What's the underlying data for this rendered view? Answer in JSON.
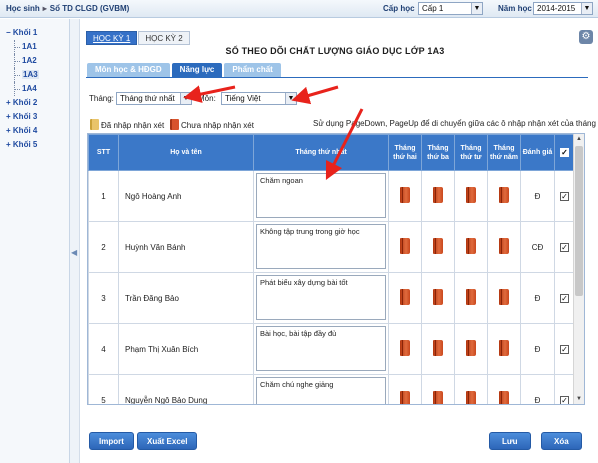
{
  "topbar": {
    "crumb_1": "Học sinh",
    "crumb_2": "Sổ TD CLGD (GVBM)",
    "cap_hoc_label": "Cấp học",
    "cap_hoc_value": "Cấp 1",
    "nam_hoc_label": "Năm học",
    "nam_hoc_value": "2014-2015"
  },
  "sidebar": {
    "items": [
      {
        "label": "Khối 1",
        "level": 0
      },
      {
        "label": "1A1",
        "level": 1
      },
      {
        "label": "1A2",
        "level": 1
      },
      {
        "label": "1A3",
        "level": 1,
        "active": true
      },
      {
        "label": "1A4",
        "level": 1
      },
      {
        "label": "Khối 2",
        "level": 0
      },
      {
        "label": "Khối 3",
        "level": 0
      },
      {
        "label": "Khối 4",
        "level": 0
      },
      {
        "label": "Khối 5",
        "level": 0
      }
    ]
  },
  "semester_tabs": [
    "HỌC KỲ 1",
    "HỌC KỲ 2"
  ],
  "page_title": "SỔ THEO DÕI CHẤT LƯỢNG GIÁO DỤC LỚP 1A3",
  "section_tabs": [
    "Môn học & HĐGD",
    "Năng lực",
    "Phẩm chất"
  ],
  "filters": {
    "thang_label": "Tháng:",
    "thang_value": "Tháng thứ nhất",
    "mon_label": "Môn:",
    "mon_value": "Tiếng Việt"
  },
  "legend": {
    "entered": "Đã nhập nhận xét",
    "not_entered": "Chưa nhập nhận xét",
    "hint": "Sử dụng PageDown, PageUp để di chuyển giữa các ô nhập nhận xét của tháng"
  },
  "table": {
    "headers": {
      "stt": "STT",
      "name": "Họ và tên",
      "m1": "Tháng thứ nhất",
      "m2": "Tháng thứ hai",
      "m3": "Tháng thứ ba",
      "m4": "Tháng thứ tư",
      "m5": "Tháng thứ năm",
      "grade": "Đánh giá"
    },
    "rows": [
      {
        "stt": "1",
        "name": "Ngô Hoàng Anh",
        "comment": "Chăm ngoan",
        "grade": "Đ",
        "checked": true
      },
      {
        "stt": "2",
        "name": "Huỳnh Văn Bánh",
        "comment": "Không tập trung trong giờ học",
        "grade": "CĐ",
        "checked": true
      },
      {
        "stt": "3",
        "name": "Trần Đăng Bảo",
        "comment": "Phát biểu xây dựng bài tốt",
        "grade": "Đ",
        "checked": true
      },
      {
        "stt": "4",
        "name": "Phạm Thị Xuân Bích",
        "comment": "Bài học, bài tập đầy đủ",
        "grade": "Đ",
        "checked": true
      },
      {
        "stt": "5",
        "name": "Nguyễn Ngô Bảo Dung",
        "comment": "Chăm chú nghe giảng",
        "grade": "Đ",
        "checked": true
      }
    ]
  },
  "buttons": {
    "import": "Import",
    "export": "Xuất Excel",
    "save": "Lưu",
    "delete": "Xóa"
  },
  "colors": {
    "accent": "#2c6bbd",
    "header_bg": "#3b78c8",
    "annotation_arrow": "#e8231c"
  }
}
